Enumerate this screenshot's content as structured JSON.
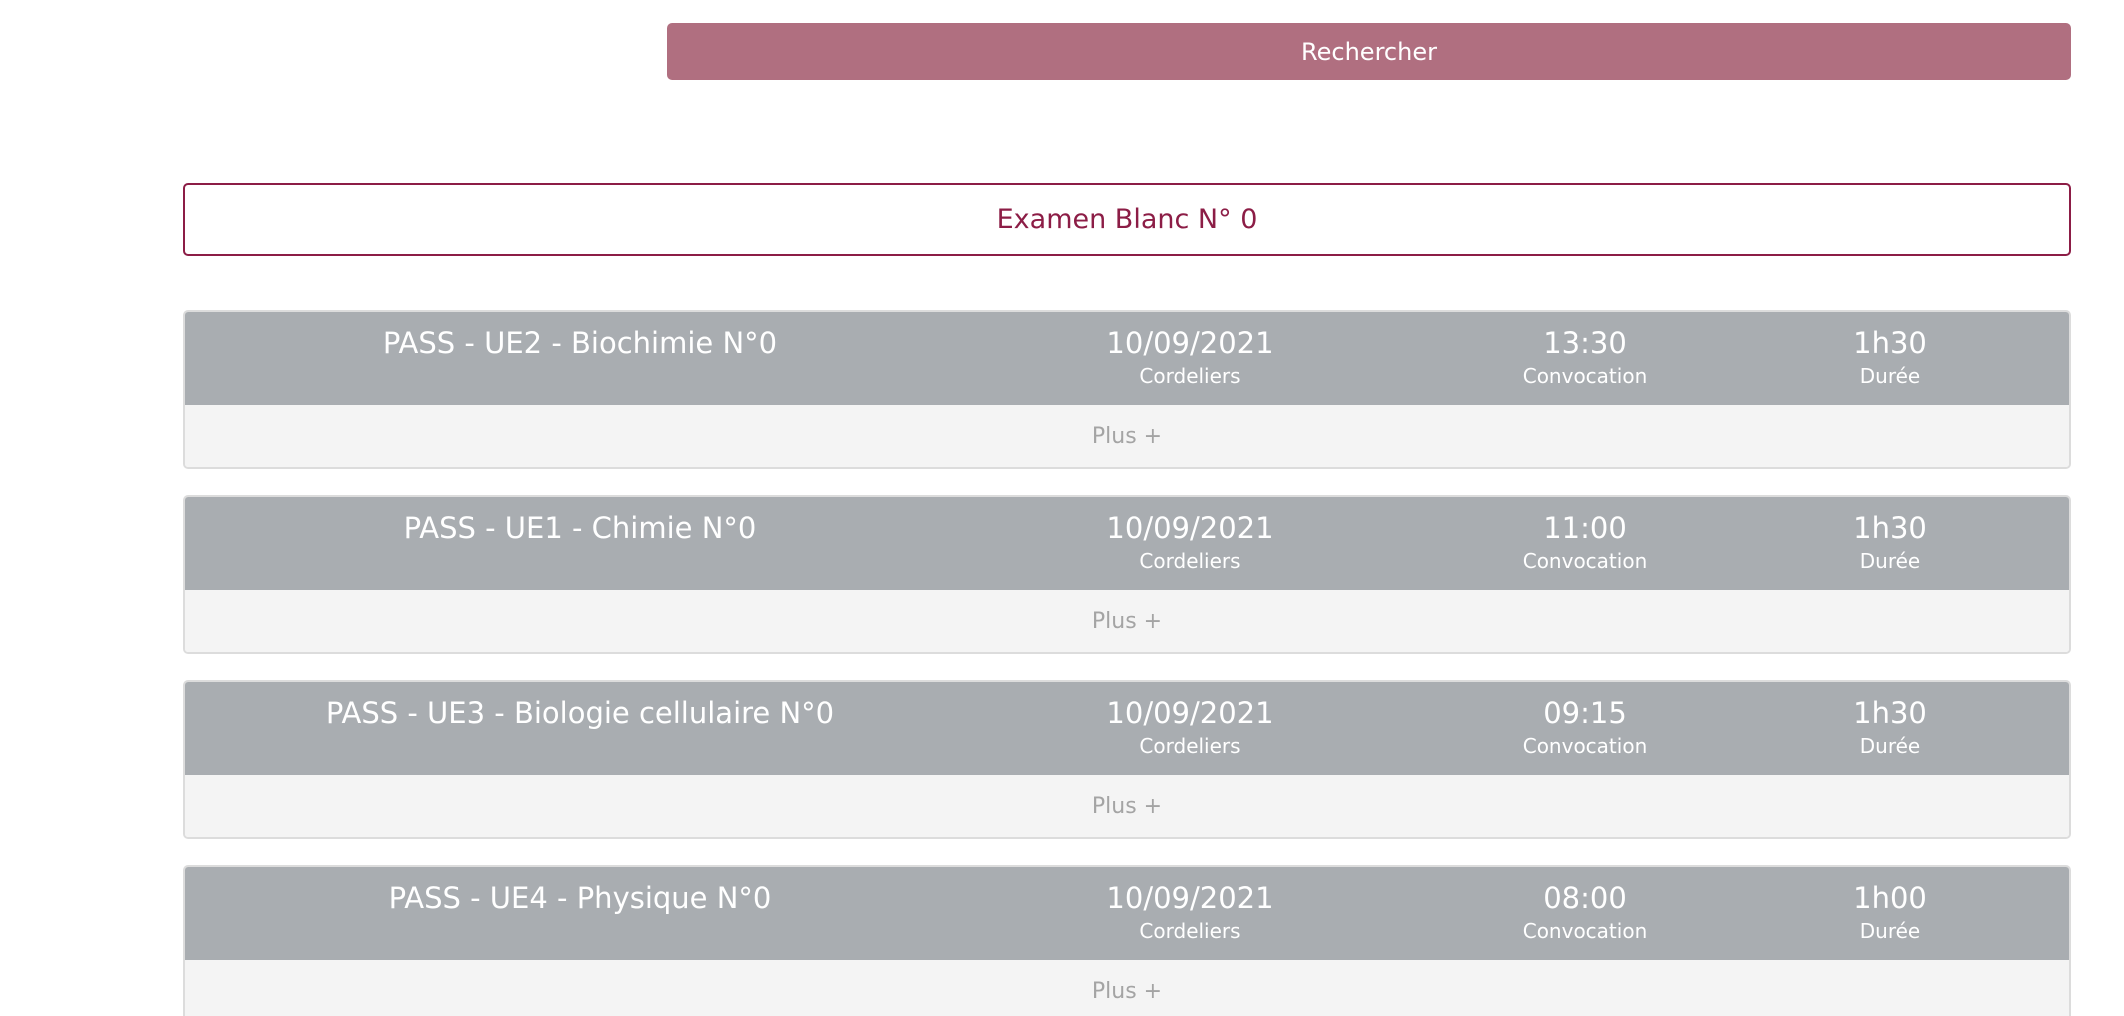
{
  "search": {
    "button_label": "Rechercher"
  },
  "exam": {
    "title": "Examen Blanc N° 0"
  },
  "accent_color": "#8c1d46",
  "button_color": "#b06f80",
  "sessions": [
    {
      "title": "PASS - UE2 - Biochimie N°0",
      "date": "10/09/2021",
      "location": "Cordeliers",
      "time": "13:30",
      "time_label": "Convocation",
      "duration": "1h30",
      "duration_label": "Durée",
      "more_label": "Plus +"
    },
    {
      "title": "PASS - UE1 - Chimie N°0",
      "date": "10/09/2021",
      "location": "Cordeliers",
      "time": "11:00",
      "time_label": "Convocation",
      "duration": "1h30",
      "duration_label": "Durée",
      "more_label": "Plus +"
    },
    {
      "title": "PASS - UE3 - Biologie cellulaire N°0",
      "date": "10/09/2021",
      "location": "Cordeliers",
      "time": "09:15",
      "time_label": "Convocation",
      "duration": "1h30",
      "duration_label": "Durée",
      "more_label": "Plus +"
    },
    {
      "title": "PASS - UE4 - Physique N°0",
      "date": "10/09/2021",
      "location": "Cordeliers",
      "time": "08:00",
      "time_label": "Convocation",
      "duration": "1h00",
      "duration_label": "Durée",
      "more_label": "Plus +"
    }
  ]
}
